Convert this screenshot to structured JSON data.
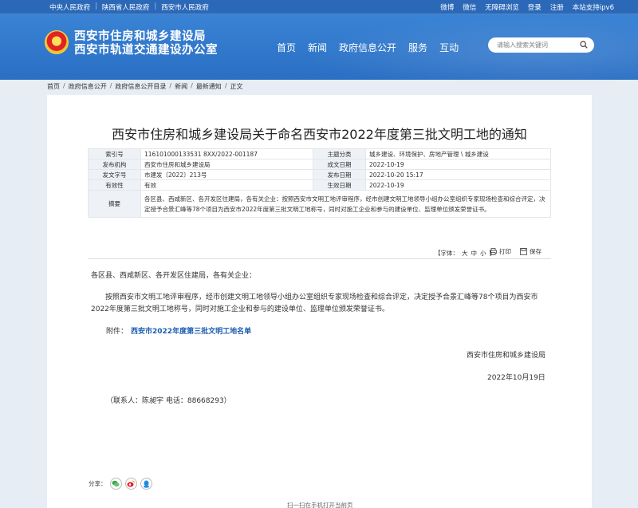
{
  "topbar": {
    "left_links": [
      "中央人民政府",
      "陕西省人民政府",
      "西安市人民政府"
    ],
    "right_links": [
      "微博",
      "微信",
      "无障碍浏览",
      "登录",
      "注册"
    ],
    "ipv6": "本站支持ipv6"
  },
  "site": {
    "title_line1": "西安市住房和城乡建设局",
    "title_line2": "西安市轨道交通建设办公室"
  },
  "nav": [
    "首页",
    "新闻",
    "政府信息公开",
    "服务",
    "互动"
  ],
  "search": {
    "placeholder": "请输入搜索关键词"
  },
  "breadcrumb": [
    "首页",
    "政府信息公开",
    "政府信息公开目录",
    "新闻",
    "最新通知",
    "正文"
  ],
  "article": {
    "title": "西安市住房和城乡建设局关于命名西安市2022年度第三批文明工地的通知",
    "meta": {
      "index_label": "索引号",
      "index_value": "116101000133531 8XX/2022-001187",
      "theme_label": "主题分类",
      "theme_value": "城乡建设、环境保护、房地产管理 \\ 城乡建设",
      "org_label": "发布机构",
      "org_value": "西安市住房和城乡建设局",
      "made_label": "成文日期",
      "made_value": "2022-10-19",
      "docno_label": "发文字号",
      "docno_value": "市建发〔2022〕213号",
      "pub_label": "发布日期",
      "pub_value": "2022-10-20 15:17",
      "valid_label": "有效性",
      "valid_value": "有效",
      "effect_label": "生效日期",
      "effect_value": "2022-10-19",
      "abstract_label": "摘要",
      "abstract_value": "各区县、西咸新区、各开发区住建局，各有关企业：按照西安市文明工地评审程序，经市创建文明工地领导小组办公室组织专家现场检查和综合评定，决定授予合景汇峰等78个项目为西安市2022年度第三批文明工地称号，同时对施工企业和参与的建设单位、监理单位颁发荣誉证书。"
    },
    "tools": {
      "font_prefix": "【字体：",
      "font_large": "大",
      "font_medium": "中",
      "font_small": "小",
      "font_suffix": "】",
      "print": "打印",
      "save": "保存"
    },
    "p1": "各区县、西咸新区、各开发区住建局，各有关企业：",
    "p2": "按照西安市文明工地评审程序，经市创建文明工地领导小组办公室组织专家现场检查和综合评定，决定授予合景汇峰等78个项目为西安市2022年度第三批文明工地称号，同时对施工企业和参与的建设单位、监理单位颁发荣誉证书。",
    "attachment_label": "附件：",
    "attachment_link": "西安市2022年度第三批文明工地名单",
    "sign_org": "西安市住房和城乡建设局",
    "sign_date": "2022年10月19日",
    "contact": "（联系人：陈昶宇 电话：88668293）",
    "share_label": "分享："
  },
  "footer_note": "扫一扫在手机打开当前页"
}
